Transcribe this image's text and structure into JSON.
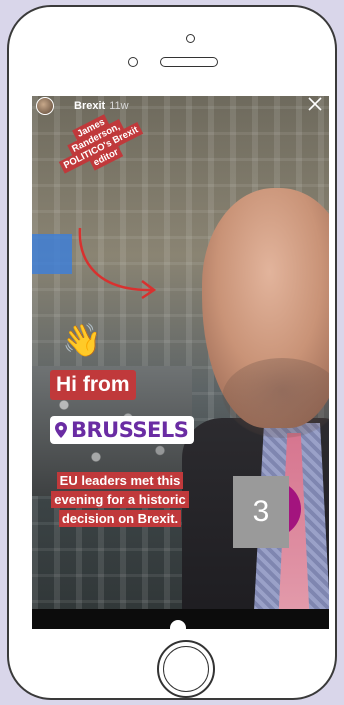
{
  "story": {
    "username": "Brexit",
    "time_ago": "11w"
  },
  "tag": {
    "lines": [
      "James",
      "Randerson,",
      "POLITICO's Brexit",
      "editor"
    ]
  },
  "stickers": {
    "wave_emoji": "👋",
    "greeting": "Hi from",
    "location": "BRUSSELS",
    "location_color": "#6a2ca3"
  },
  "caption": {
    "lines": [
      "EU leaders met this",
      "evening for a historic",
      "decision on Brexit."
    ]
  },
  "overlay": {
    "badge_number": "3"
  },
  "colors": {
    "sticker_red": "#c0393b",
    "page_background": "#d9d6ea",
    "marker_magenta": "#a3147e"
  }
}
